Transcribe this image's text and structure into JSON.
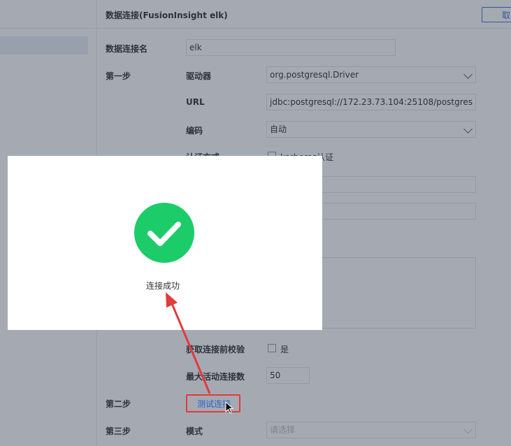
{
  "header": {
    "title": "数据连接(FusionInsight elk)",
    "cancel_label": "取"
  },
  "form": {
    "conn_name_label": "数据连接名",
    "conn_name_value": "elk",
    "step1_label": "第一步",
    "driver_label": "驱动器",
    "driver_value": "org.postgresql.Driver",
    "url_label": "URL",
    "url_value": "jdbc:postgresql://172.23.73.104:25108/postgres",
    "encoding_label": "编码",
    "encoding_value": "自动",
    "auth_label": "认证方式",
    "kerberos_label": "kerberos认证",
    "validate_label": "获取连接前校验",
    "validate_option": "是",
    "max_active_label": "最大活动连接数",
    "max_active_value": "50",
    "step2_label": "第二步",
    "test_conn_label": "测试连接",
    "step3_label": "第三步",
    "mode_label": "模式",
    "mode_placeholder": "请选择"
  },
  "modal": {
    "message": "连接成功"
  },
  "colors": {
    "success": "#1ccc68",
    "annotation": "#e13b3b",
    "accent": "#3d6fd1"
  },
  "icons": {
    "success": "check-icon",
    "cursor": "mouse-pointer-icon",
    "annotation": "red-arrow"
  }
}
